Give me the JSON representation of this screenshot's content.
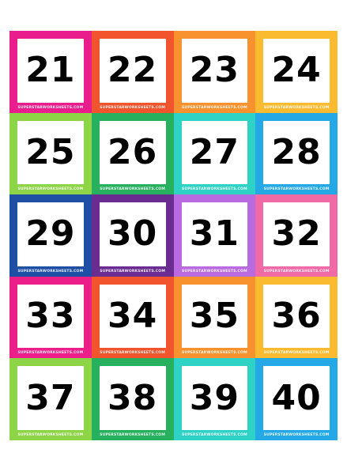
{
  "cards": [
    {
      "number": "21",
      "color": "#e91e8c",
      "footer": "SUPERSTARWORKSHEETS.COM"
    },
    {
      "number": "22",
      "color": "#f2542d",
      "footer": "SUPERSTARWORKSHEETS.COM"
    },
    {
      "number": "23",
      "color": "#f7922e",
      "footer": "SUPERSTARWORKSHEETS.COM"
    },
    {
      "number": "24",
      "color": "#fbbb31",
      "footer": "SUPERSTARWORKSHEETS.COM"
    },
    {
      "number": "25",
      "color": "#8dd447",
      "footer": "SUPERSTARWORKSHEETS.COM"
    },
    {
      "number": "26",
      "color": "#27b15f",
      "footer": "SUPERSTARWORKSHEETS.COM"
    },
    {
      "number": "27",
      "color": "#2ed3c6",
      "footer": "SUPERSTARWORKSHEETS.COM"
    },
    {
      "number": "28",
      "color": "#24a9e6",
      "footer": "SUPERSTARWORKSHEETS.COM"
    },
    {
      "number": "29",
      "color": "#1e4fa5",
      "footer": "SUPERSTARWORKSHEETS.COM"
    },
    {
      "number": "30",
      "color": "#6a2c91",
      "footer": "SUPERSTARWORKSHEETS.COM"
    },
    {
      "number": "31",
      "color": "#b96ae0",
      "footer": "SUPERSTARWORKSHEETS.COM"
    },
    {
      "number": "32",
      "color": "#f06aa6",
      "footer": "SUPERSTARWORKSHEETS.COM"
    },
    {
      "number": "33",
      "color": "#ec1e8a",
      "footer": "SUPERSTARWORKSHEETS.COM"
    },
    {
      "number": "34",
      "color": "#f2542d",
      "footer": "SUPERSTARWORKSHEETS.COM"
    },
    {
      "number": "35",
      "color": "#f7922e",
      "footer": "SUPERSTARWORKSHEETS.COM"
    },
    {
      "number": "36",
      "color": "#fbbb31",
      "footer": "SUPERSTARWORKSHEETS.COM"
    },
    {
      "number": "37",
      "color": "#8dd447",
      "footer": "SUPERSTARWORKSHEETS.COM"
    },
    {
      "number": "38",
      "color": "#27b15f",
      "footer": "SUPERSTARWORKSHEETS.COM"
    },
    {
      "number": "39",
      "color": "#2ed3c6",
      "footer": "SUPERSTARWORKSHEETS.COM"
    },
    {
      "number": "40",
      "color": "#24a9e6",
      "footer": "SUPERSTARWORKSHEETS.COM"
    }
  ]
}
